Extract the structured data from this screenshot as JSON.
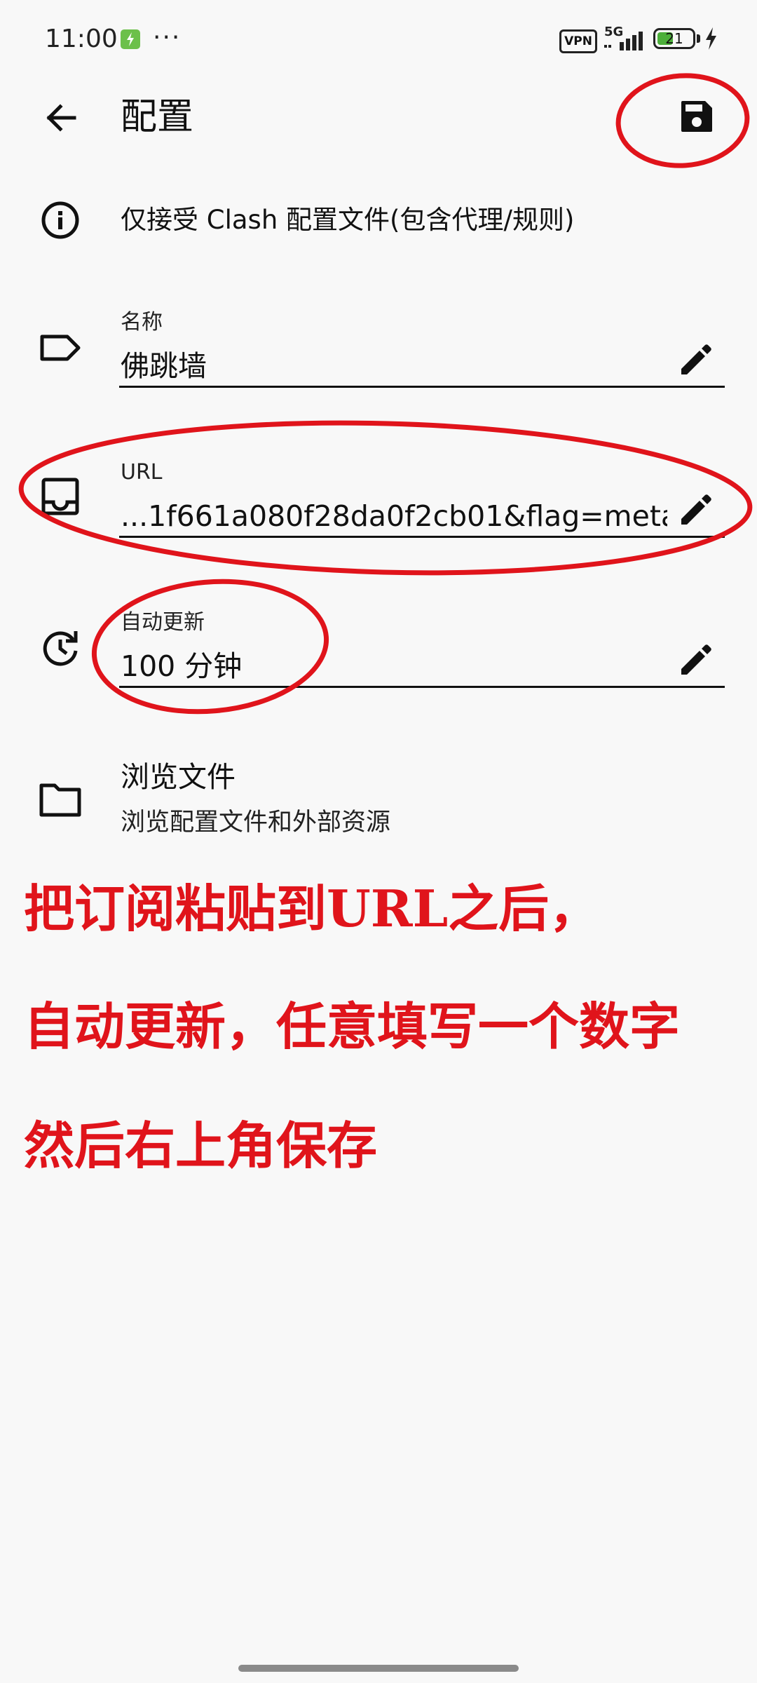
{
  "status_bar": {
    "time": "11:00",
    "more": "···",
    "vpn": "VPN",
    "network": "5G",
    "battery": "21"
  },
  "app_bar": {
    "title": "配置",
    "back_icon": "arrow-back-icon",
    "save_icon": "save-icon"
  },
  "info": {
    "text": "仅接受 Clash 配置文件(包含代理/规则)",
    "icon": "info-icon"
  },
  "fields": {
    "name": {
      "label": "名称",
      "value": "佛跳墙",
      "icon": "label-tag-icon"
    },
    "url": {
      "label": "URL",
      "value": "...1f661a080f28da0f2cb01&flag=meta",
      "icon": "inbox-icon"
    },
    "auto_update": {
      "label": "自动更新",
      "value": "100 分钟",
      "icon": "update-clock-icon"
    }
  },
  "browse": {
    "title": "浏览文件",
    "subtitle": "浏览配置文件和外部资源",
    "icon": "folder-icon"
  },
  "annotation": {
    "line1": "把订阅粘贴到URL之后，",
    "line2": "自动更新，任意填写一个数字",
    "line3": "然后右上角保存",
    "color": "#e0141b"
  }
}
